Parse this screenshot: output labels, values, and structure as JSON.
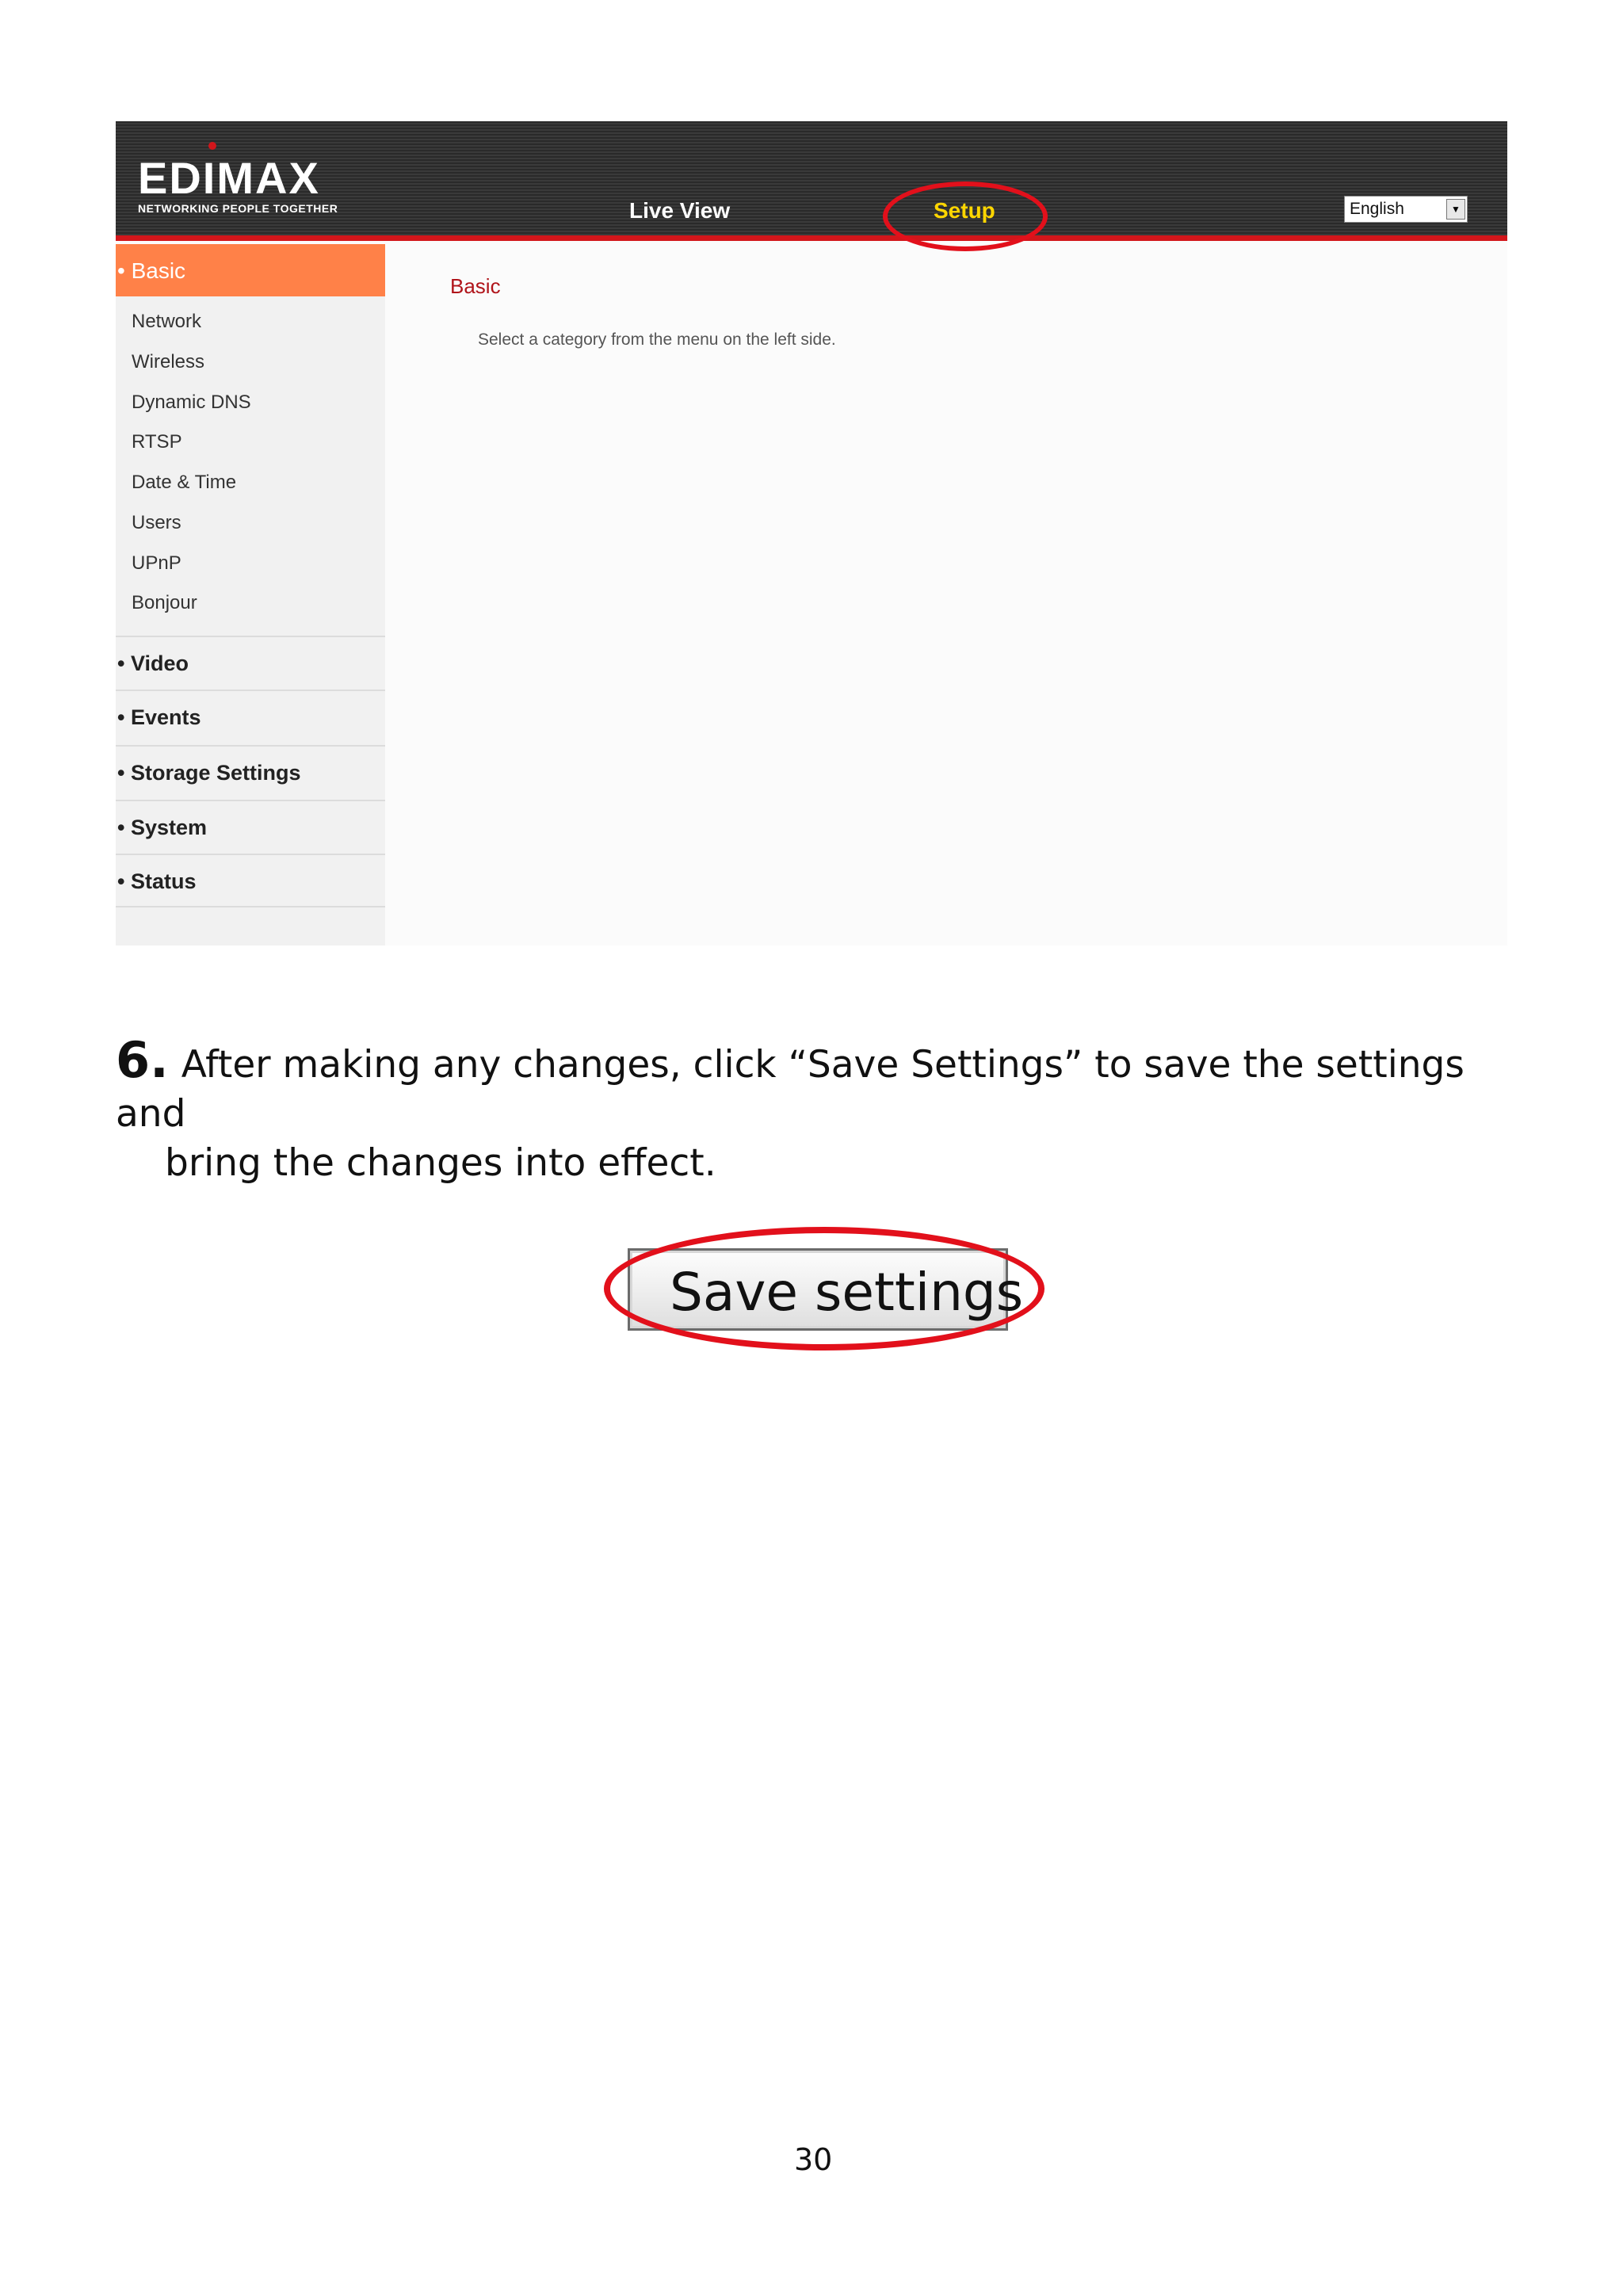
{
  "header": {
    "logo_text": "EDIMAX",
    "logo_tagline": "NETWORKING PEOPLE TOGETHER",
    "nav_live_view": "Live View",
    "nav_setup": "Setup",
    "language_selected": "English"
  },
  "sidebar": {
    "active_section": "• Basic",
    "sub_items": [
      "Network",
      "Wireless",
      "Dynamic DNS",
      "RTSP",
      "Date & Time",
      "Users",
      "UPnP",
      "Bonjour"
    ],
    "sections": [
      "• Video",
      "• Events",
      "• Storage  Settings",
      "• System",
      "• Status"
    ]
  },
  "content": {
    "title": "Basic",
    "hint": "Select a category from the menu on the left side."
  },
  "document": {
    "step_number": "6.",
    "step_line1": "After making any changes, click “Save Settings” to save the settings and",
    "step_line2": "bring the changes into effect.",
    "save_button_label": "Save settings",
    "page_number": "30"
  },
  "colors": {
    "highlight_ring": "#e2101b",
    "active_nav": "#ffd600",
    "sidebar_active": "#ff8148",
    "accent_red": "#d2161b"
  }
}
